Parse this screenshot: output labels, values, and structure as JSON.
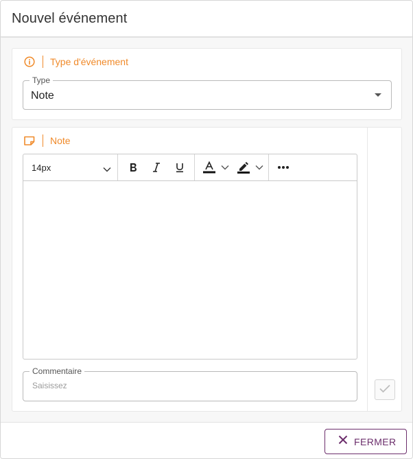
{
  "dialog": {
    "title": "Nouvel événement",
    "close_label": "FERMER"
  },
  "type_section": {
    "label": "Type d'événement",
    "field_legend": "Type",
    "selected_value": "Note"
  },
  "note_section": {
    "label": "Note",
    "toolbar": {
      "font_size": "14px"
    },
    "comment": {
      "legend": "Commentaire",
      "placeholder": "Saisissez"
    }
  },
  "colors": {
    "accent": "#f08a2a",
    "primary": "#6b2d6b"
  }
}
